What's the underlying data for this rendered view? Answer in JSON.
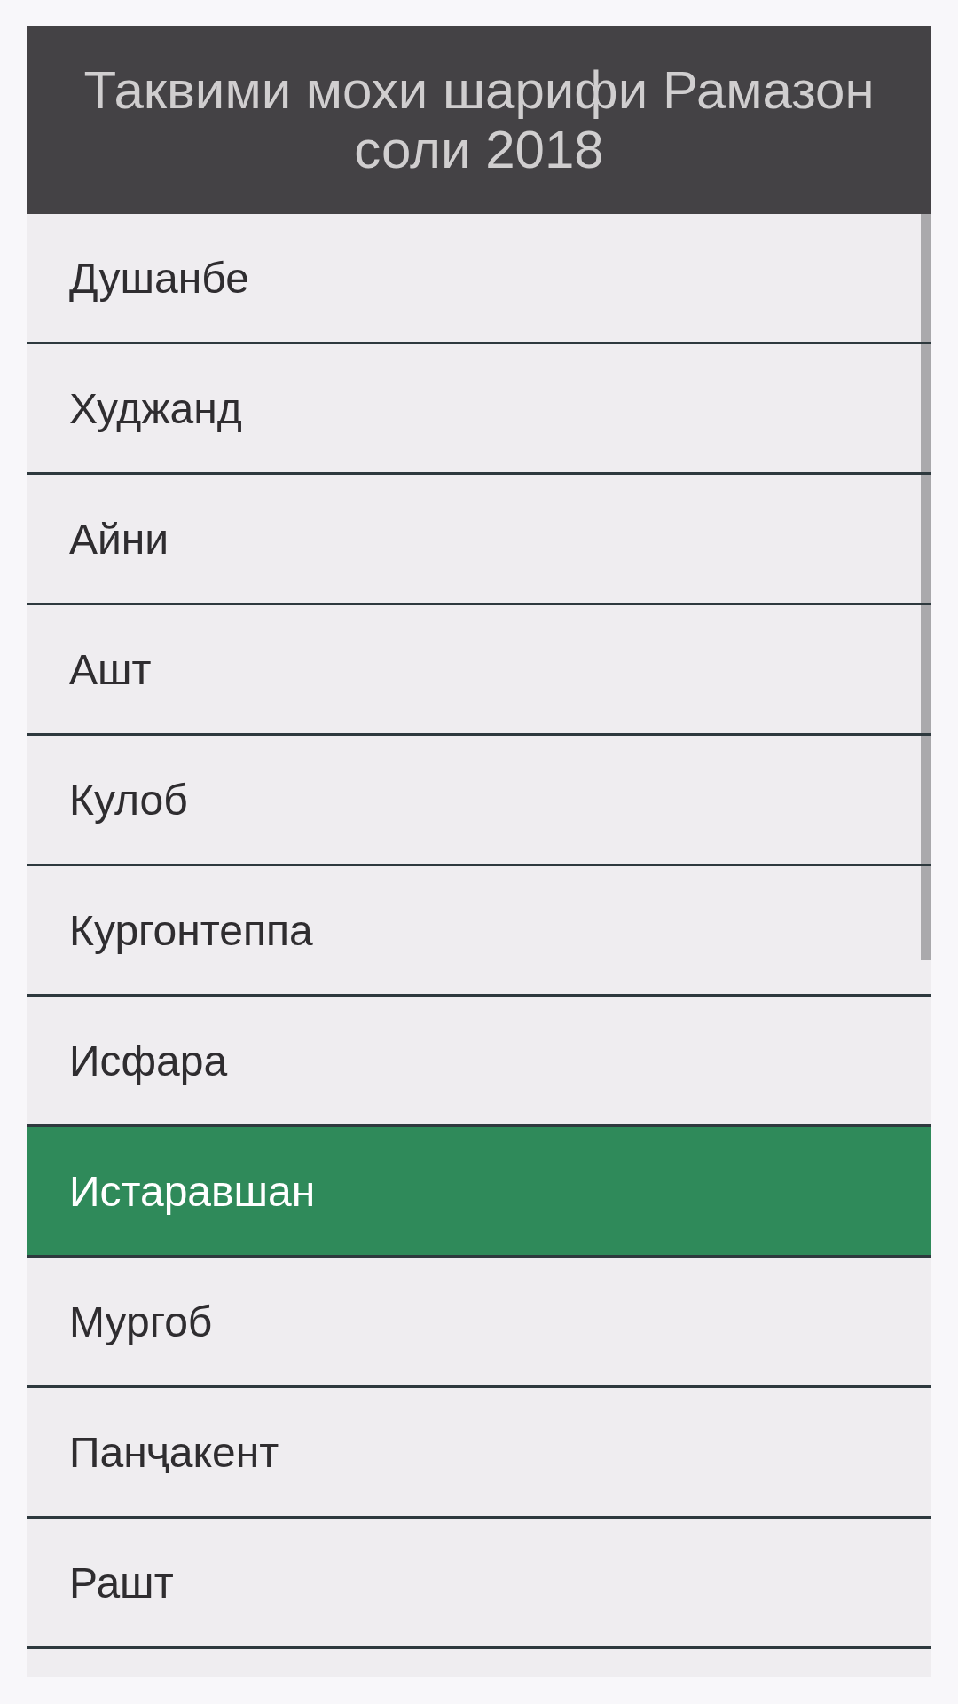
{
  "header": {
    "title": "Таквими мохи шарифи Рамазон соли 2018"
  },
  "cities": [
    {
      "name": "Душанбе",
      "selected": false
    },
    {
      "name": "Худжанд",
      "selected": false
    },
    {
      "name": "Айни",
      "selected": false
    },
    {
      "name": "Ашт",
      "selected": false
    },
    {
      "name": "Кулоб",
      "selected": false
    },
    {
      "name": "Кургонтеппа",
      "selected": false
    },
    {
      "name": "Исфара",
      "selected": false
    },
    {
      "name": "Истаравшан",
      "selected": true
    },
    {
      "name": "Мургоб",
      "selected": false
    },
    {
      "name": "Панҷакент",
      "selected": false
    },
    {
      "name": "Рашт",
      "selected": false
    }
  ]
}
